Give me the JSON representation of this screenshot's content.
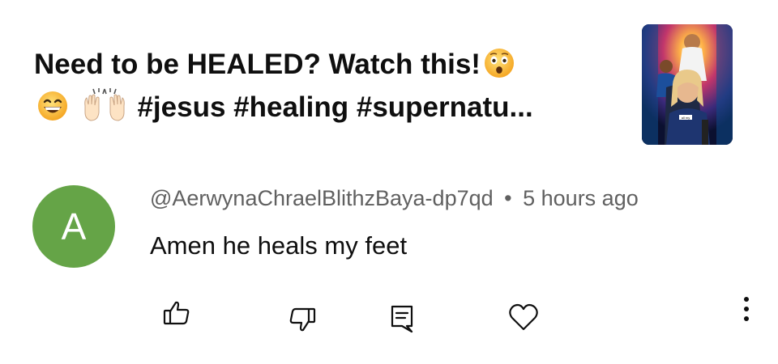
{
  "video": {
    "title_part1": "Need to be HEALED? Watch this!",
    "title_part2": "#jesus #healing #supernatu...",
    "thumbnail_caption": "all my"
  },
  "comment": {
    "avatar_letter": "A",
    "avatar_color": "#65a447",
    "author": "@AerwynaChraelBlithzBaya-dp7qd",
    "separator": "•",
    "time": "5 hours ago",
    "text": "Amen he heals my feet"
  },
  "actions": {
    "icons": [
      "thumbs-up-icon",
      "thumbs-down-icon",
      "reply-icon",
      "heart-icon",
      "more-vertical-icon"
    ]
  }
}
